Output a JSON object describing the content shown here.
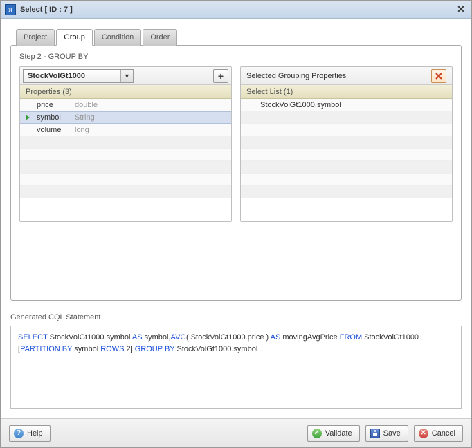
{
  "titlebar": {
    "app_glyph": "π",
    "title": "Select [ ID : 7 ]"
  },
  "tabs": [
    {
      "label": "Project",
      "active": false
    },
    {
      "label": "Group",
      "active": true
    },
    {
      "label": "Condition",
      "active": false
    },
    {
      "label": "Order",
      "active": false
    }
  ],
  "step_label": "Step 2 - GROUP BY",
  "left": {
    "dropdown_value": "StockVolGt1000",
    "add_glyph": "+",
    "list_header": "Properties (3)",
    "properties": [
      {
        "name": "price",
        "type": "double",
        "selected": false
      },
      {
        "name": "symbol",
        "type": "String",
        "selected": true
      },
      {
        "name": "volume",
        "type": "long",
        "selected": false
      }
    ]
  },
  "right": {
    "title": "Selected Grouping Properties",
    "list_header": "Select List (1)",
    "items": [
      "StockVolGt1000.symbol"
    ]
  },
  "generated_label": "Generated CQL Statement",
  "cql_tokens": [
    {
      "t": "SELECT",
      "kw": true
    },
    {
      "t": " StockVolGt1000.symbol "
    },
    {
      "t": "AS",
      "kw": true
    },
    {
      "t": " symbol,"
    },
    {
      "t": "AVG",
      "kw": true
    },
    {
      "t": "( StockVolGt1000.price ) "
    },
    {
      "t": "AS",
      "kw": true
    },
    {
      "t": " movingAvgPrice "
    },
    {
      "t": "FROM",
      "kw": true
    },
    {
      "t": " StockVolGt1000  ["
    },
    {
      "t": "PARTITION BY",
      "kw": true
    },
    {
      "t": " symbol  "
    },
    {
      "t": "ROWS",
      "kw": true
    },
    {
      "t": " 2] "
    },
    {
      "t": "GROUP BY",
      "kw": true
    },
    {
      "t": " StockVolGt1000.symbol"
    }
  ],
  "footer": {
    "help": "Help",
    "validate": "Validate",
    "save": "Save",
    "cancel": "Cancel"
  }
}
